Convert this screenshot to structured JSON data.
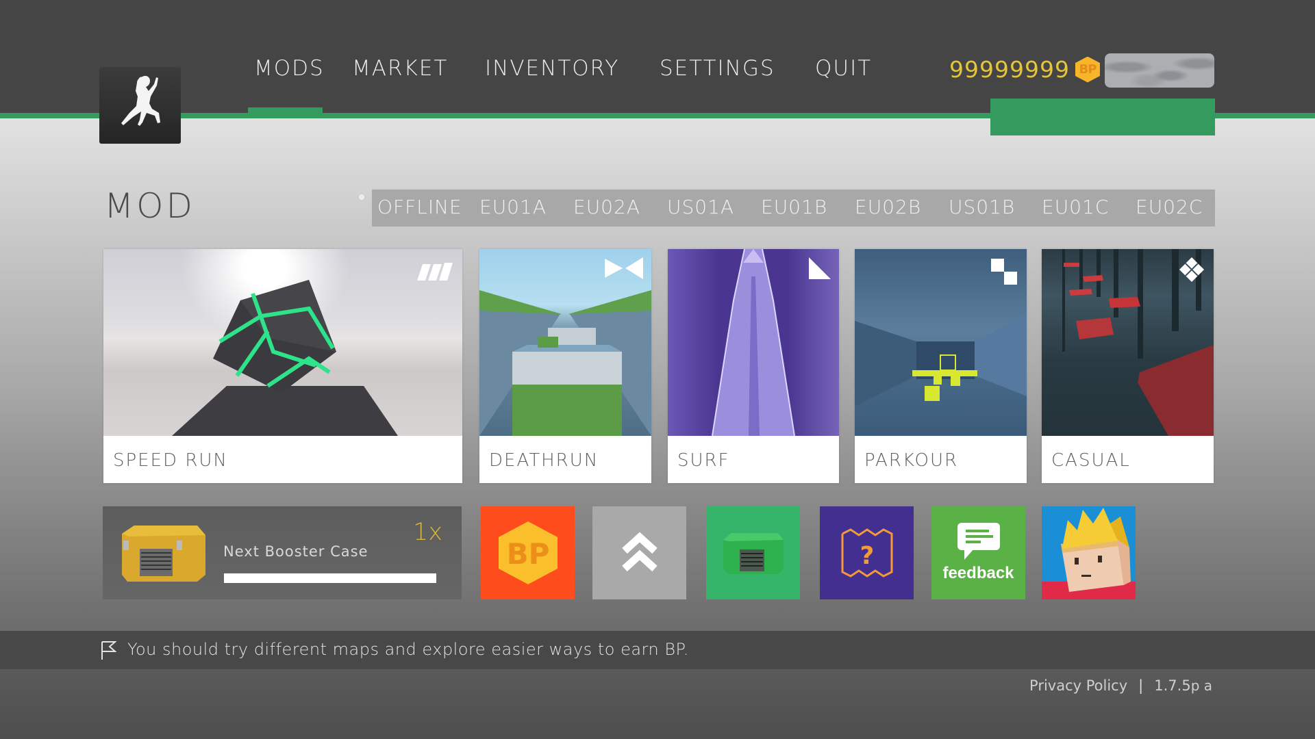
{
  "app": {
    "logo_alt": "jumping-player-logo"
  },
  "nav": {
    "items": [
      {
        "label": "MODS",
        "active": true
      },
      {
        "label": "MARKET",
        "active": false
      },
      {
        "label": "INVENTORY",
        "active": false
      },
      {
        "label": "SETTINGS",
        "active": false
      },
      {
        "label": "QUIT",
        "active": false
      }
    ]
  },
  "currency": {
    "amount": "99999999",
    "unit": "BP",
    "color": "#e5c53a"
  },
  "mod_section": {
    "title": "MOD",
    "servers": [
      "OFFLINE",
      "EU01A",
      "EU02A",
      "US01A",
      "EU01B",
      "EU02B",
      "US01B",
      "EU01C",
      "EU02C"
    ]
  },
  "mods": [
    {
      "label": "SPEED RUN",
      "icon": "speed-stripes-icon"
    },
    {
      "label": "DEATHRUN",
      "icon": "bowtie-icon"
    },
    {
      "label": "SURF",
      "icon": "triangle-icon"
    },
    {
      "label": "PARKOUR",
      "icon": "checker-icon"
    },
    {
      "label": "CASUAL",
      "icon": "diamond-grid-icon"
    }
  ],
  "booster": {
    "label": "Next Booster Case",
    "count": "1x",
    "progress": 1.0
  },
  "tiles": [
    {
      "name": "bp-shop",
      "text": "BP",
      "color": "#fe4c1c"
    },
    {
      "name": "rank-up",
      "color": "#a9a9a9"
    },
    {
      "name": "green-case",
      "color": "#35b56a"
    },
    {
      "name": "map-help",
      "text": "?",
      "color": "#432f8f"
    },
    {
      "name": "feedback",
      "text": "feedback",
      "color": "#5ab247"
    },
    {
      "name": "character",
      "color": "#1b8fd6"
    }
  ],
  "tip": {
    "text": "You should try different maps and explore easier ways to earn BP."
  },
  "footer": {
    "privacy": "Privacy Policy",
    "separator": "|",
    "version": "1.7.5",
    "version_suffix": "p a"
  },
  "colors": {
    "accent_green": "#359a5e",
    "topbar": "#454545"
  }
}
